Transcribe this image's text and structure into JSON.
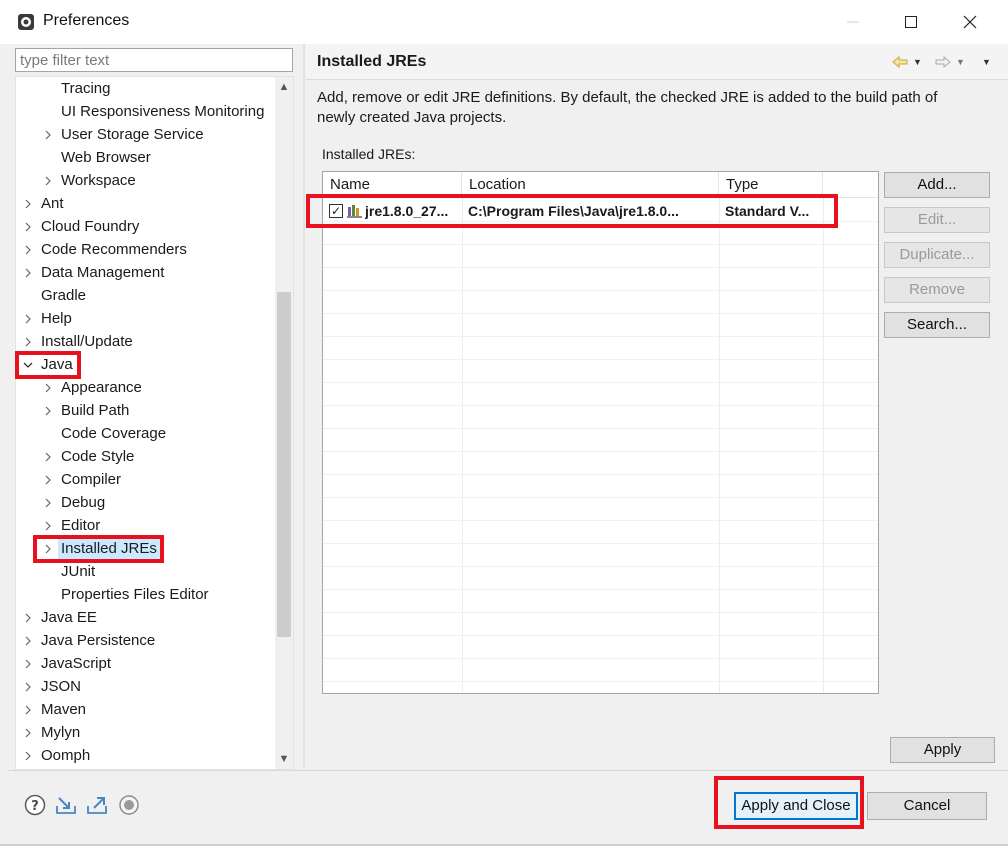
{
  "window": {
    "title": "Preferences",
    "icon": "eclipse-gear-icon"
  },
  "filter": {
    "placeholder": "type filter text"
  },
  "tree": {
    "items": [
      {
        "label": "Tracing",
        "level": 2,
        "expander": "none"
      },
      {
        "label": "UI Responsiveness Monitoring",
        "level": 2,
        "expander": "none"
      },
      {
        "label": "User Storage Service",
        "level": 2,
        "expander": "collapsed"
      },
      {
        "label": "Web Browser",
        "level": 2,
        "expander": "none"
      },
      {
        "label": "Workspace",
        "level": 2,
        "expander": "collapsed"
      },
      {
        "label": "Ant",
        "level": 1,
        "expander": "collapsed"
      },
      {
        "label": "Cloud Foundry",
        "level": 1,
        "expander": "collapsed"
      },
      {
        "label": "Code Recommenders",
        "level": 1,
        "expander": "collapsed"
      },
      {
        "label": "Data Management",
        "level": 1,
        "expander": "collapsed"
      },
      {
        "label": "Gradle",
        "level": 1,
        "expander": "none"
      },
      {
        "label": "Help",
        "level": 1,
        "expander": "collapsed"
      },
      {
        "label": "Install/Update",
        "level": 1,
        "expander": "collapsed"
      },
      {
        "label": "Java",
        "level": 1,
        "expander": "expanded"
      },
      {
        "label": "Appearance",
        "level": 2,
        "expander": "collapsed"
      },
      {
        "label": "Build Path",
        "level": 2,
        "expander": "collapsed"
      },
      {
        "label": "Code Coverage",
        "level": 2,
        "expander": "none"
      },
      {
        "label": "Code Style",
        "level": 2,
        "expander": "collapsed"
      },
      {
        "label": "Compiler",
        "level": 2,
        "expander": "collapsed"
      },
      {
        "label": "Debug",
        "level": 2,
        "expander": "collapsed"
      },
      {
        "label": "Editor",
        "level": 2,
        "expander": "collapsed"
      },
      {
        "label": "Installed JREs",
        "level": 2,
        "expander": "collapsed",
        "selected": true
      },
      {
        "label": "JUnit",
        "level": 2,
        "expander": "none"
      },
      {
        "label": "Properties Files Editor",
        "level": 2,
        "expander": "none"
      },
      {
        "label": "Java EE",
        "level": 1,
        "expander": "collapsed"
      },
      {
        "label": "Java Persistence",
        "level": 1,
        "expander": "collapsed"
      },
      {
        "label": "JavaScript",
        "level": 1,
        "expander": "collapsed"
      },
      {
        "label": "JSON",
        "level": 1,
        "expander": "collapsed"
      },
      {
        "label": "Maven",
        "level": 1,
        "expander": "collapsed"
      },
      {
        "label": "Mylyn",
        "level": 1,
        "expander": "collapsed"
      },
      {
        "label": "Oomph",
        "level": 1,
        "expander": "collapsed"
      }
    ]
  },
  "page": {
    "title": "Installed JREs",
    "description": "Add, remove or edit JRE definitions. By default, the checked JRE is added to the build path of newly created Java projects.",
    "table_label": "Installed JREs:",
    "columns": [
      "Name",
      "Location",
      "Type"
    ],
    "rows": [
      {
        "checked": true,
        "name": "jre1.8.0_27...",
        "location": "C:\\Program Files\\Java\\jre1.8.0...",
        "type": "Standard V..."
      }
    ]
  },
  "buttons": {
    "add": "Add...",
    "edit": "Edit...",
    "duplicate": "Duplicate...",
    "remove": "Remove",
    "search": "Search...",
    "apply": "Apply",
    "apply_close": "Apply and Close",
    "cancel": "Cancel"
  },
  "footer_icons": [
    "help-icon",
    "import-icon",
    "export-icon",
    "record-icon"
  ],
  "colors": {
    "highlight": "#e8121f",
    "selection": "#cce8ff",
    "focus": "#0078d7"
  }
}
